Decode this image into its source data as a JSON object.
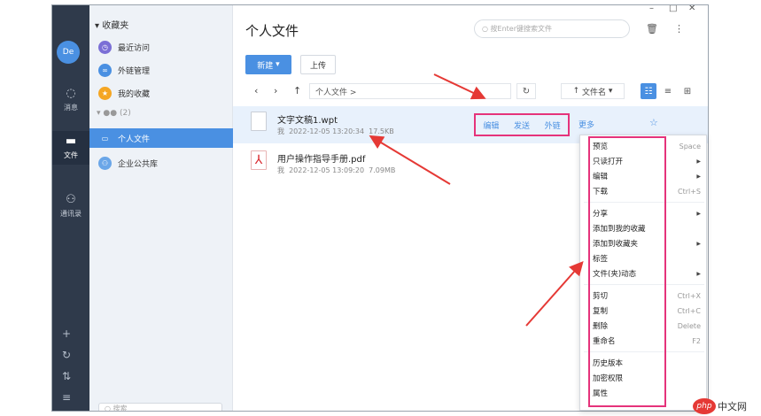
{
  "rail": {
    "avatar": "De",
    "items": [
      {
        "label": "消息",
        "icon": "chat-icon"
      },
      {
        "label": "文件",
        "icon": "folder-icon"
      },
      {
        "label": "通讯录",
        "icon": "contacts-icon"
      }
    ],
    "bottom_icons": [
      "plus-icon",
      "refresh-icon",
      "transfer-icon",
      "menu-icon"
    ]
  },
  "tree": {
    "header": "收藏夹",
    "items": [
      {
        "label": "最近访问",
        "color": "#7b6fd6"
      },
      {
        "label": "外链管理",
        "color": "#4a90e2"
      },
      {
        "label": "我的收藏",
        "color": "#f5a623"
      }
    ],
    "blurred_group": "(2)",
    "group_items": [
      {
        "label": "个人文件",
        "active": true
      },
      {
        "label": "企业公共库",
        "color": "#4a90e2"
      }
    ],
    "search_placeholder": "搜索"
  },
  "main": {
    "title": "个人文件",
    "search_placeholder": "按Enter键搜索文件",
    "new_button": "新建",
    "upload_button": "上传",
    "breadcrumb": "个人文件  >",
    "sort_label": "文件名",
    "files": [
      {
        "name": "文字文稿1.wpt",
        "owner": "我",
        "date": "2022-12-05 13:20:34",
        "size": "17.5KB"
      },
      {
        "name": "用户操作指导手册.pdf",
        "owner": "我",
        "date": "2022-12-05 13:09:20",
        "size": "7.09MB"
      }
    ],
    "actions": [
      "编辑",
      "发送",
      "外链"
    ],
    "more": "更多"
  },
  "context_menu": [
    {
      "label": "预览",
      "shortcut": "Space"
    },
    {
      "label": "只读打开",
      "submenu": true
    },
    {
      "label": "编辑",
      "submenu": true
    },
    {
      "label": "下载",
      "shortcut": "Ctrl+S"
    },
    {
      "label": "分享",
      "submenu": true
    },
    {
      "label": "添加到我的收藏"
    },
    {
      "label": "添加到收藏夹",
      "submenu": true
    },
    {
      "label": "标签"
    },
    {
      "label": "文件(夹)动态",
      "submenu": true
    },
    {
      "label": "剪切",
      "shortcut": "Ctrl+X"
    },
    {
      "label": "复制",
      "shortcut": "Ctrl+C"
    },
    {
      "label": "删除",
      "shortcut": "Delete"
    },
    {
      "label": "重命名",
      "shortcut": "F2"
    },
    {
      "label": "历史版本"
    },
    {
      "label": "加密权限"
    },
    {
      "label": "属性"
    }
  ],
  "watermark": {
    "badge": "php",
    "text": "中文网"
  },
  "colors": {
    "accent": "#4a90e2",
    "highlight": "#e5337b",
    "rail": "#2f3a4b"
  }
}
